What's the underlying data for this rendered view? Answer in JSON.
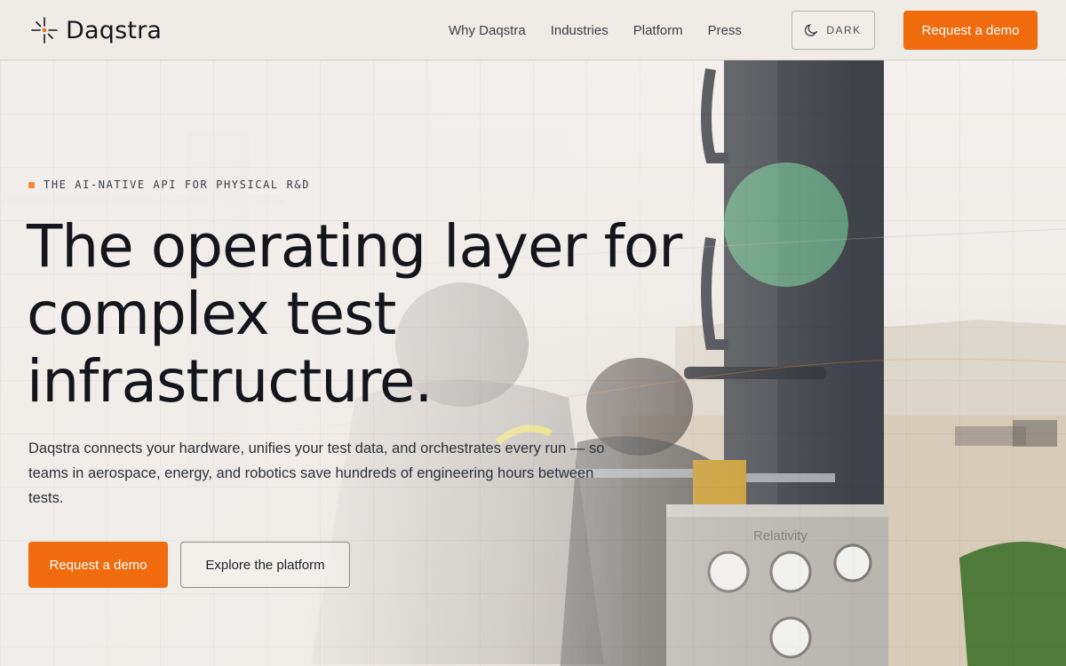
{
  "header": {
    "brand_name": "Daqstra",
    "nav_items": [
      "Why Daqstra",
      "Industries",
      "Platform",
      "Press"
    ],
    "theme_toggle_label": "DARK",
    "cta_label": "Request a demo"
  },
  "hero": {
    "eyebrow": "THE AI-NATIVE API FOR PHYSICAL R&D",
    "headline_lines": [
      "The operating layer for",
      "complex test",
      "infrastructure."
    ],
    "subtext": "Daqstra connects your hardware, unifies your test data, and orchestrates every run — so teams in aerospace, energy, and robotics save hundreds of engineering hours between tests.",
    "primary_cta": "Request a demo",
    "secondary_cta": "Explore the platform",
    "photo_label": "Relativity"
  },
  "colors": {
    "accent": "#ef6b0e",
    "background": "#efebe6",
    "text": "#14161c"
  },
  "icons": {
    "logo": "spark-logo-icon",
    "theme": "moon-icon"
  }
}
